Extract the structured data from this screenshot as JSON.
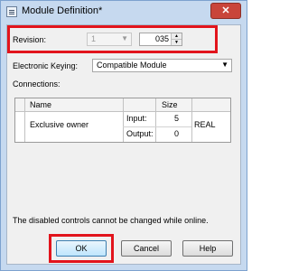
{
  "window": {
    "title": "Module Definition*",
    "close_glyph": "✕"
  },
  "revision": {
    "label": "Revision:",
    "major_value": "1",
    "minor_value": "035"
  },
  "keying": {
    "label": "Electronic Keying:",
    "value": "Compatible Module"
  },
  "connections": {
    "label": "Connections:",
    "columns": [
      "Name",
      "Size"
    ],
    "row": {
      "name": "Exclusive owner",
      "input_label": "Input:",
      "input_value": "5",
      "output_label": "Output:",
      "output_value": "0",
      "data_type": "REAL"
    }
  },
  "note": "The disabled controls cannot be changed while online.",
  "buttons": {
    "ok": "OK",
    "cancel": "Cancel",
    "help": "Help"
  },
  "colors": {
    "highlight": "#e2141c",
    "close_button": "#c9453a",
    "frame": "#c6d9ef"
  }
}
